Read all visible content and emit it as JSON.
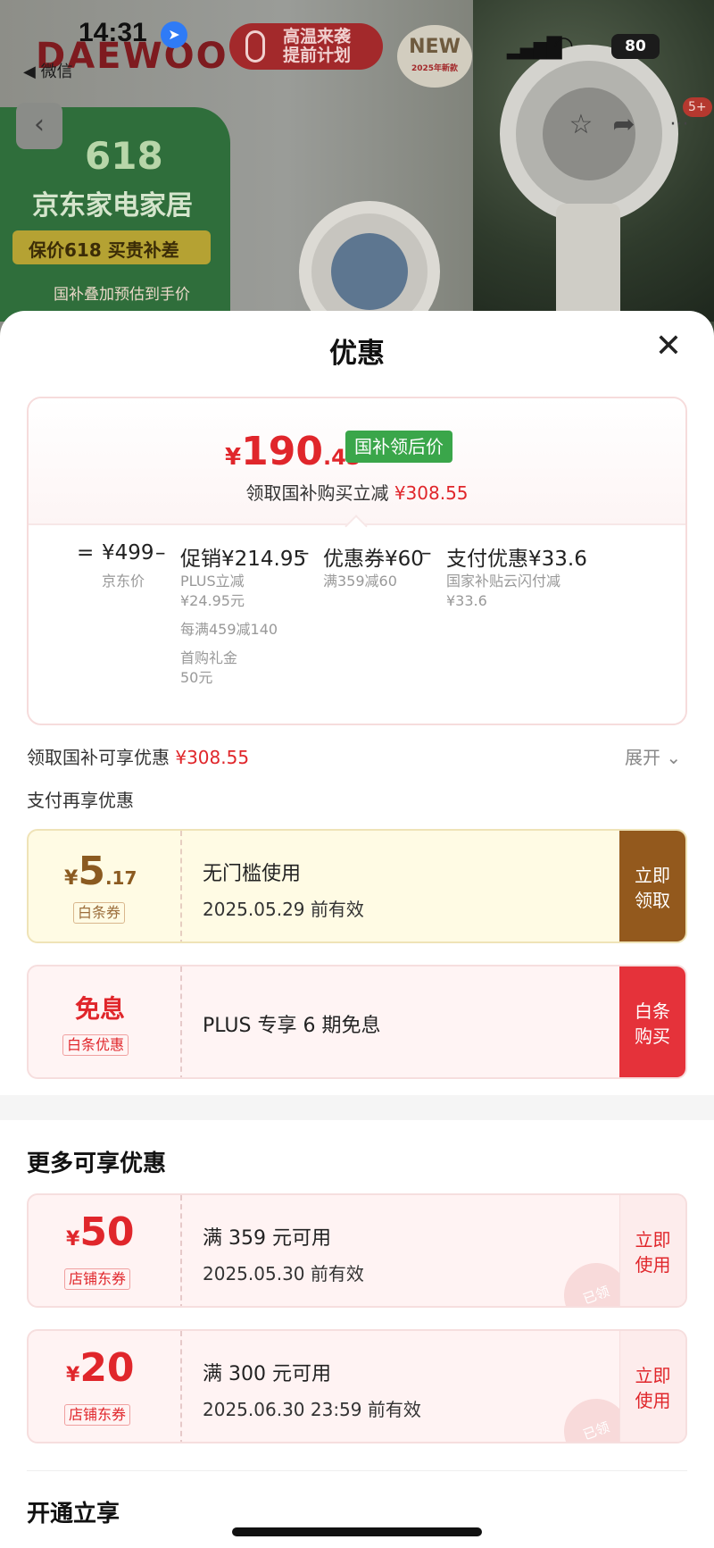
{
  "status_bar": {
    "time": "14:31",
    "back_app": "◀ 微信",
    "battery": "80"
  },
  "background": {
    "brand": "DAEWOO",
    "heat_banner_line1": "高温来袭",
    "heat_banner_line2": "提前计划",
    "new_badge": "NEW",
    "new_badge_sub": "2025年新款",
    "promo_618": "618",
    "promo_title": "京东家电家居",
    "promo_subtitle": "保价618 买贵补差",
    "promo_note": "国补叠加预估到手价",
    "cart_count": "5+"
  },
  "sheet": {
    "title": "优惠",
    "close_icon": "close-icon"
  },
  "price_calc": {
    "final_symbol": "¥",
    "final_int": "190",
    "final_dec": ".45",
    "final_tag": "国补领后价",
    "subtitle_prefix": "领取国补购买立减 ",
    "subtitle_amount": "¥308.55",
    "equals": "=",
    "jd_price": "¥499",
    "jd_price_label": "京东价",
    "minus1": "–",
    "promo": "促销¥214.95",
    "promo_detail1a": "PLUS立减",
    "promo_detail1b": "¥24.95元",
    "promo_detail2": "每满459减140",
    "promo_detail3a": "首购礼金",
    "promo_detail3b": "50元",
    "minus2": "–",
    "coupon": "优惠券¥60",
    "coupon_detail": "满359减60",
    "minus3": "–",
    "pay": "支付优惠¥33.6",
    "pay_detail_a": "国家补贴云闪付减",
    "pay_detail_b": "¥33.6"
  },
  "savings_row": {
    "label": "领取国补可享优惠 ",
    "amount": "¥308.55",
    "expand": "展开 ⌄"
  },
  "pay_section_title": "支付再享优惠",
  "pay_coupons": [
    {
      "symbol": "¥",
      "int": "5",
      "dec": ".17",
      "label": "白条券",
      "line1": "无门槛使用",
      "line2": "2025.05.29 前有效",
      "action1": "立即",
      "action2": "领取"
    },
    {
      "big": "免息",
      "label": "白条优惠",
      "line1": "PLUS 专享 6 期免息",
      "action1": "白条",
      "action2": "购买"
    }
  ],
  "more_section_title": "更多可享优惠",
  "more_coupons": [
    {
      "symbol": "¥",
      "int": "50",
      "label": "店铺东券",
      "line1": "满 359 元可用",
      "line2": "2025.05.30 前有效",
      "action1": "立即",
      "action2": "使用",
      "stamp": "已领"
    },
    {
      "symbol": "¥",
      "int": "20",
      "label": "店铺东券",
      "line1": "满 300 元可用",
      "line2": "2025.06.30 23:59 前有效",
      "action1": "立即",
      "action2": "使用",
      "stamp": "已领"
    }
  ],
  "open_section_title": "开通立享",
  "colors": {
    "accent_red": "#e0262b",
    "gold_action": "#93591d",
    "red_action": "#e5323a",
    "tag_green": "#3aa64a"
  }
}
